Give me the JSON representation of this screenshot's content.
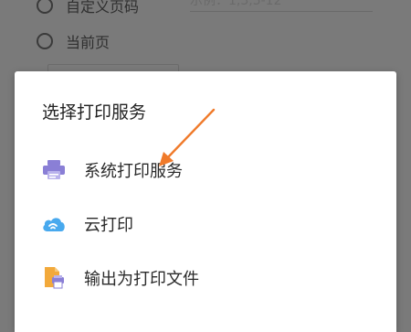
{
  "background": {
    "option_custom": {
      "label": "自定义页码",
      "hint": "示例：1,3,5-12"
    },
    "option_current": {
      "label": "当前页"
    }
  },
  "dialog": {
    "title": "选择打印服务",
    "options": [
      {
        "label": "系统打印服务",
        "icon": "printer-icon"
      },
      {
        "label": "云打印",
        "icon": "cloud-print-icon"
      },
      {
        "label": "输出为打印文件",
        "icon": "print-file-icon"
      }
    ]
  },
  "colors": {
    "overlay": "#7a7a7a",
    "printer_purple": "#8a7fd6",
    "cloud_blue": "#48a9ee",
    "file_orange": "#f2a93b",
    "arrow_orange": "#f07a2a"
  }
}
